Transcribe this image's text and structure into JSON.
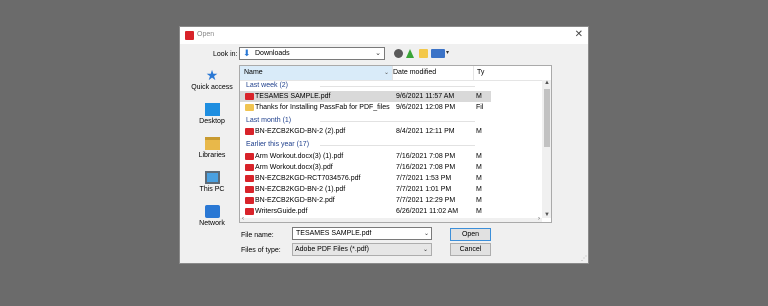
{
  "dialog": {
    "title": "Open",
    "close_glyph": "✕",
    "icon": "acrobat-icon"
  },
  "look_in": {
    "label": "Look in:",
    "value": "Downloads",
    "icon": "download-folder-icon"
  },
  "toolbar": {
    "buttons": [
      {
        "name": "back-icon"
      },
      {
        "name": "up-folder-icon"
      },
      {
        "name": "new-folder-icon"
      },
      {
        "name": "view-menu-icon"
      }
    ]
  },
  "places": [
    {
      "label": "Quick access",
      "icon": "star-icon"
    },
    {
      "label": "Desktop",
      "icon": "desktop-icon"
    },
    {
      "label": "Libraries",
      "icon": "libraries-icon"
    },
    {
      "label": "This PC",
      "icon": "computer-icon"
    },
    {
      "label": "Network",
      "icon": "network-icon"
    }
  ],
  "columns": {
    "name": "Name",
    "date": "Date modified",
    "type": "Ty"
  },
  "groups": [
    {
      "label": "Last week (2)"
    },
    {
      "label": "Last month (1)"
    },
    {
      "label": "Earlier this year (17)"
    }
  ],
  "files": [
    {
      "name": "TESAMES SAMPLE.pdf",
      "date": "9/6/2021 11:57 AM",
      "type": "M",
      "kind": "pdf",
      "selected": true
    },
    {
      "name": "Thanks for Installing PassFab for PDF_files",
      "date": "9/6/2021 12:08 PM",
      "type": "Fil",
      "kind": "folder"
    },
    {
      "name": "BN-EZCB2KGD-BN-2 (2).pdf",
      "date": "8/4/2021 12:11 PM",
      "type": "M",
      "kind": "pdf"
    },
    {
      "name": "Arm Workout.docx(3) (1).pdf",
      "date": "7/16/2021 7:08 PM",
      "type": "M",
      "kind": "pdf"
    },
    {
      "name": "Arm Workout.docx(3).pdf",
      "date": "7/16/2021 7:08 PM",
      "type": "M",
      "kind": "pdf"
    },
    {
      "name": "BN-EZCB2KGD-RCT7034576.pdf",
      "date": "7/7/2021 1:53 PM",
      "type": "M",
      "kind": "pdf"
    },
    {
      "name": "BN-EZCB2KGD-BN-2 (1).pdf",
      "date": "7/7/2021 1:01 PM",
      "type": "M",
      "kind": "pdf"
    },
    {
      "name": "BN-EZCB2KGD-BN-2.pdf",
      "date": "7/7/2021 12:29 PM",
      "type": "M",
      "kind": "pdf"
    },
    {
      "name": "WritersGuide.pdf",
      "date": "6/26/2021 11:02 AM",
      "type": "M",
      "kind": "pdf"
    }
  ],
  "file_name": {
    "label": "File name:",
    "value": "TESAMES SAMPLE.pdf"
  },
  "file_type": {
    "label": "Files of type:",
    "value": "Adobe PDF Files (*.pdf)"
  },
  "buttons": {
    "open": "Open",
    "cancel": "Cancel"
  }
}
